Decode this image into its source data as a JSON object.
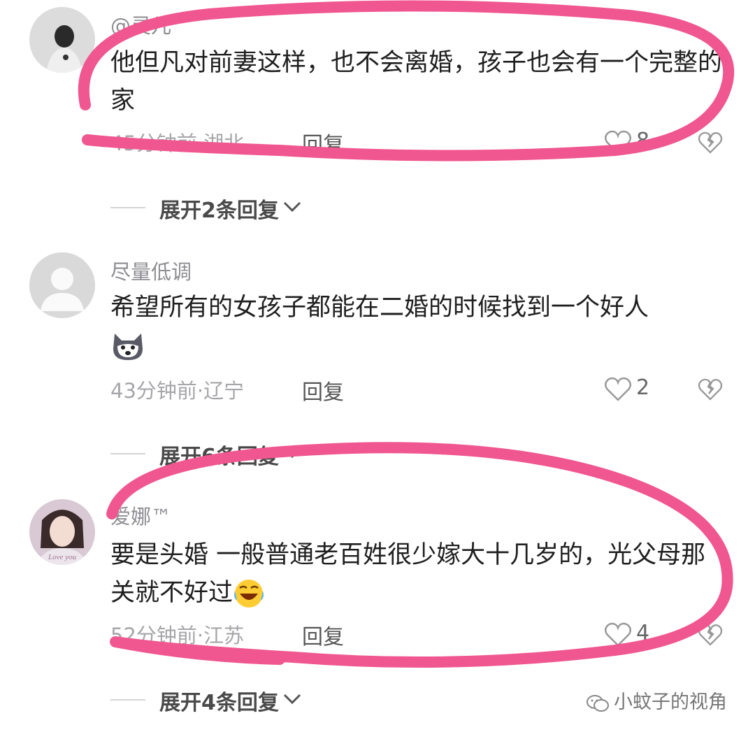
{
  "comments": [
    {
      "username": "@灵儿",
      "content": "他但凡对前妻这样，也不会离婚，孩子也会有一个完整的家",
      "meta": "45分钟前·湖北",
      "reply_label": "回复",
      "likes": "8",
      "expand_label": "展开2条回复"
    },
    {
      "username": "尽量低调",
      "content": "希望所有的女孩子都能在二婚的时候找到一个好人",
      "emoji": "dog-face-emoji",
      "meta": "43分钟前·辽宁",
      "reply_label": "回复",
      "likes": "2",
      "expand_label": "展开6条回复"
    },
    {
      "username": "爱娜™",
      "content": "要是头婚 一般普通老百姓很少嫁大十几岁的，光父母那关就不好过",
      "emoji": "rolling-laugh-emoji",
      "meta": "52分钟前·江苏",
      "reply_label": "回复",
      "likes": "4",
      "expand_label": "展开4条回复",
      "avatar_caption": "Love you"
    }
  ],
  "watermark": "小蚊子的视角",
  "colors": {
    "highlight_circle": "#f0568f",
    "text_primary": "#1f1f1f",
    "text_secondary": "#8e8e93"
  },
  "icons": [
    "heart-outline-icon",
    "broken-heart-icon",
    "chevron-down-icon",
    "wechat-icon"
  ]
}
